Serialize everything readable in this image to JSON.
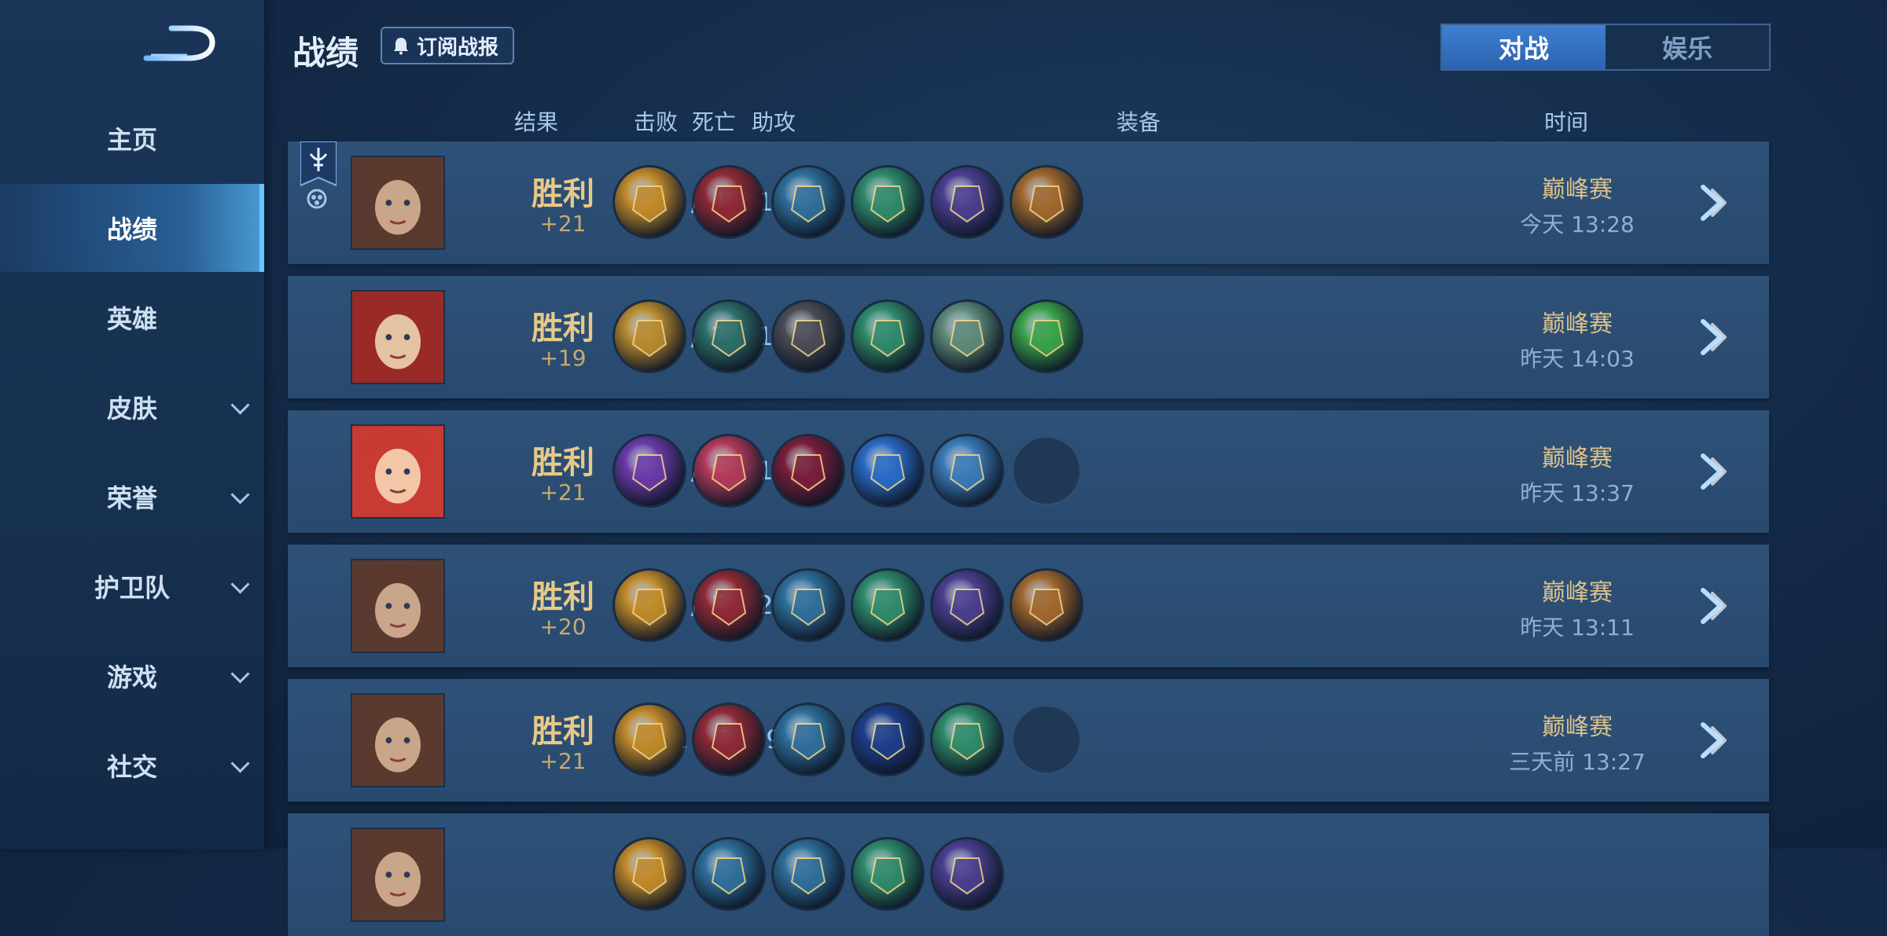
{
  "sidebar": {
    "items": [
      {
        "label": "主页",
        "has_chevron": false,
        "active": false
      },
      {
        "label": "战绩",
        "has_chevron": false,
        "active": true
      },
      {
        "label": "英雄",
        "has_chevron": false,
        "active": false
      },
      {
        "label": "皮肤",
        "has_chevron": true,
        "active": false
      },
      {
        "label": "荣誉",
        "has_chevron": true,
        "active": false
      },
      {
        "label": "护卫队",
        "has_chevron": true,
        "active": false
      },
      {
        "label": "游戏",
        "has_chevron": true,
        "active": false
      },
      {
        "label": "社交",
        "has_chevron": true,
        "active": false
      }
    ]
  },
  "header": {
    "title": "战绩",
    "subscribe_label": "订阅战报",
    "tabs": [
      {
        "label": "对战",
        "active": true
      },
      {
        "label": "娱乐",
        "active": false
      }
    ]
  },
  "columns": {
    "result": "结果",
    "kill": "击败",
    "death": "死亡",
    "assist": "助攻",
    "equipment": "装备",
    "time": "时间"
  },
  "matches": [
    {
      "result": "胜利",
      "points": "+21",
      "kda": "4 / 4 / 19",
      "mode": "巅峰赛",
      "time": "今天 13:28",
      "mvp": true,
      "hero_colors": [
        "#5a3a2e",
        "#c9a58a"
      ],
      "items": [
        "#c08a2a",
        "#8e2a36",
        "#2f6e9a",
        "#2f8a6a",
        "#4a3f8e",
        "#a0682e"
      ]
    },
    {
      "result": "胜利",
      "points": "+19",
      "kda": "2 / 2 / 10",
      "mode": "巅峰赛",
      "time": "昨天 14:03",
      "mvp": false,
      "hero_colors": [
        "#9a2a26",
        "#e4c3a0"
      ],
      "items": [
        "#b88a2e",
        "#2e6e6a",
        "#4c4c56",
        "#2f8a6a",
        "#5e8a7a",
        "#3aa24a"
      ]
    },
    {
      "result": "胜利",
      "points": "+21",
      "kda": "9 / 6 / 17",
      "mode": "巅峰赛",
      "time": "昨天 13:37",
      "mvp": false,
      "hero_colors": [
        "#c83a32",
        "#f2c6a6"
      ],
      "items": [
        "#6a3aa8",
        "#b23a5a",
        "#7a1e3a",
        "#2a6ac4",
        "#3a7ab8"
      ],
      "empty_slot": true
    },
    {
      "result": "胜利",
      "points": "+20",
      "kda": "3 / 5 / 23",
      "mode": "巅峰赛",
      "time": "昨天 13:11",
      "mvp": false,
      "hero_colors": [
        "#5a3a2e",
        "#c9a58a"
      ],
      "items": [
        "#c08a2a",
        "#8e2a36",
        "#2f6e9a",
        "#2f8a6a",
        "#4a3f8e",
        "#a0682e"
      ]
    },
    {
      "result": "胜利",
      "points": "+21",
      "kda": "1 / 2 / 9",
      "mode": "巅峰赛",
      "time": "三天前 13:27",
      "mvp": false,
      "hero_colors": [
        "#5a3a2e",
        "#c9a58a"
      ],
      "items": [
        "#c08a2a",
        "#8e2a36",
        "#2f6e9a",
        "#1e3e8a",
        "#2f8a6a"
      ],
      "empty_slot": true
    }
  ],
  "partial_row": {
    "hero_colors": [
      "#5a3a2e",
      "#c9a58a"
    ],
    "items": [
      "#c08a2a",
      "#2f6e9a",
      "#2f6e9a",
      "#2f8a6a",
      "#4a3f8e"
    ]
  }
}
